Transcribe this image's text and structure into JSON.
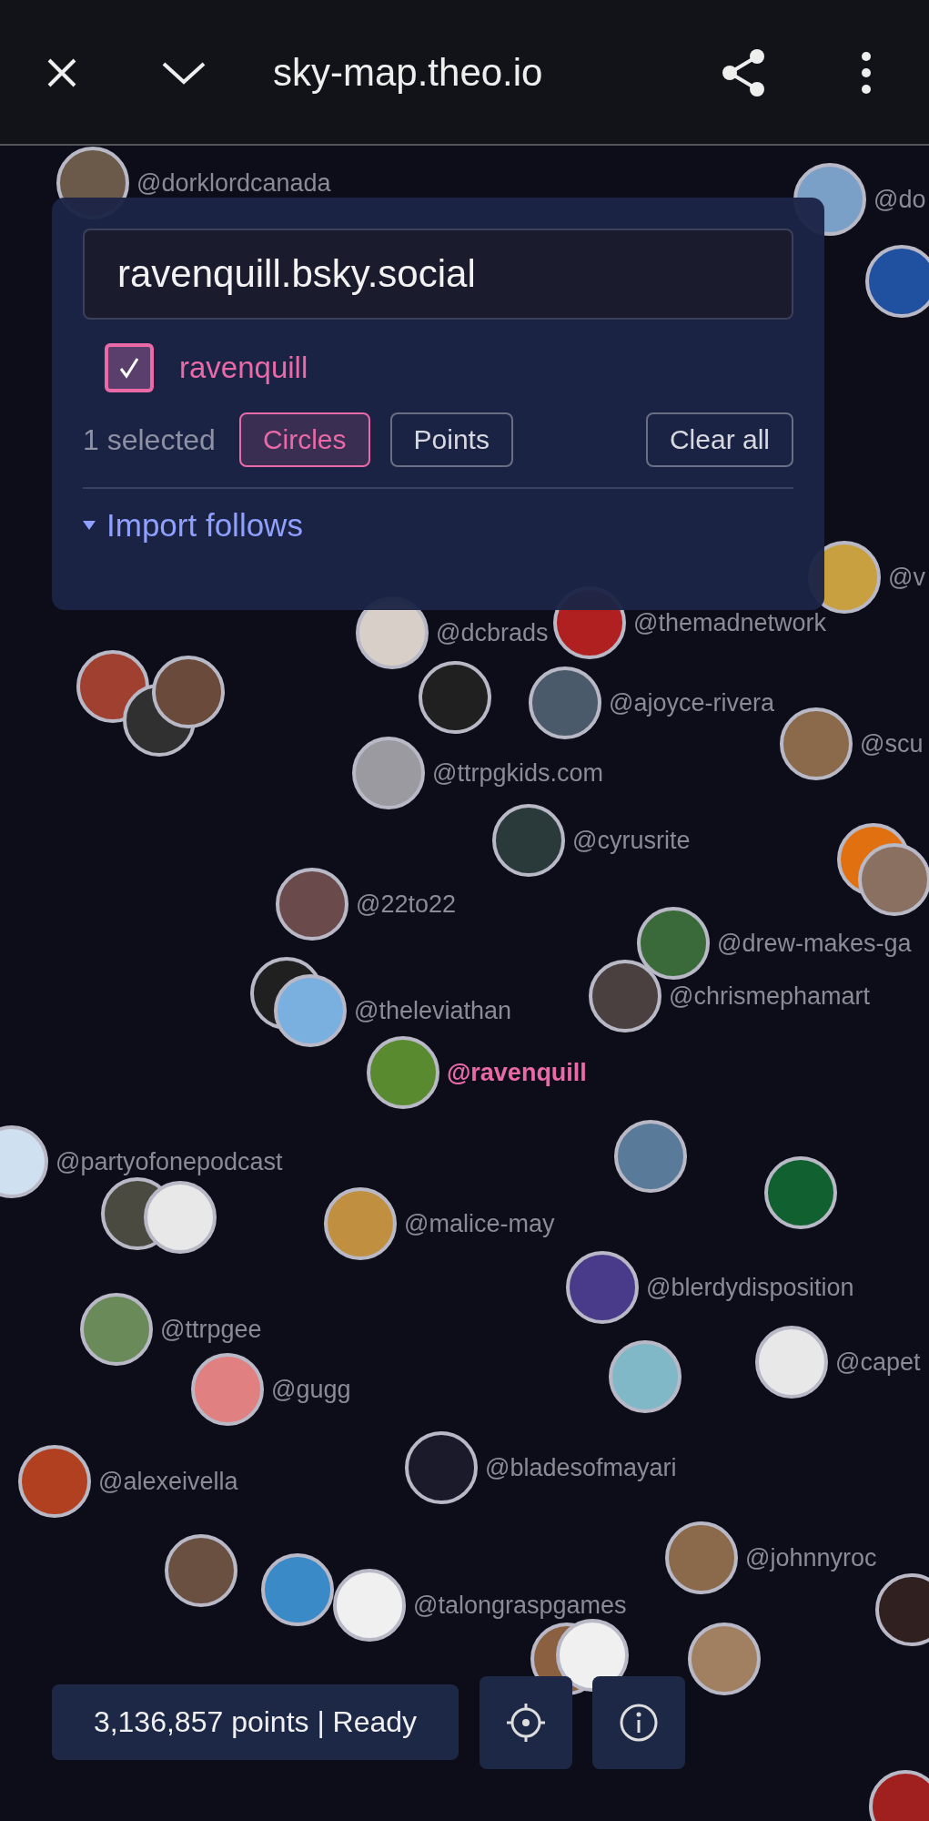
{
  "browser_bar": {
    "url": "sky-map.theo.io"
  },
  "search_panel": {
    "search": {
      "value": "ravenquill.bsky.social"
    },
    "results": [
      {
        "label": "ravenquill",
        "checked": true
      }
    ],
    "selected_count": "1 selected",
    "display_modes": [
      {
        "label": "Circles",
        "selected": true
      },
      {
        "label": "Points",
        "selected": false
      }
    ],
    "clear_button": "Clear all",
    "import_toggle": "Import follows"
  },
  "map": {
    "nodes": [
      {
        "label": "@dorklordcanada",
        "highlighted": false
      },
      {
        "label": "@do",
        "highlighted": false
      },
      {
        "label": "@v",
        "highlighted": false
      },
      {
        "label": "@dcbrads",
        "highlighted": false
      },
      {
        "label": "@themadnetwork",
        "highlighted": false
      },
      {
        "label": "@ajoyce-rivera",
        "highlighted": false
      },
      {
        "label": "@scu",
        "highlighted": false
      },
      {
        "label": "@ttrpgkids.com",
        "highlighted": false
      },
      {
        "label": "@cyrusrite",
        "highlighted": false
      },
      {
        "label": "@22to22",
        "highlighted": false
      },
      {
        "label": "@drew-makes-ga",
        "highlighted": false
      },
      {
        "label": "@theleviathan",
        "highlighted": false
      },
      {
        "label": "@chrismephamart",
        "highlighted": false
      },
      {
        "label": "@ravenquill",
        "highlighted": true
      },
      {
        "label": "@partyofonepodcast",
        "highlighted": false
      },
      {
        "label": "@malice-may",
        "highlighted": false
      },
      {
        "label": "@blerdydisposition",
        "highlighted": false
      },
      {
        "label": "@ttrpgee",
        "highlighted": false
      },
      {
        "label": "@gugg",
        "highlighted": false
      },
      {
        "label": "@capet",
        "highlighted": false
      },
      {
        "label": "@alexeivella",
        "highlighted": false
      },
      {
        "label": "@bladesofmayari",
        "highlighted": false
      },
      {
        "label": "@johnnyroc",
        "highlighted": false
      },
      {
        "label": "@talongraspgames",
        "highlighted": false
      }
    ]
  },
  "status": "3,136,857 points | Ready"
}
